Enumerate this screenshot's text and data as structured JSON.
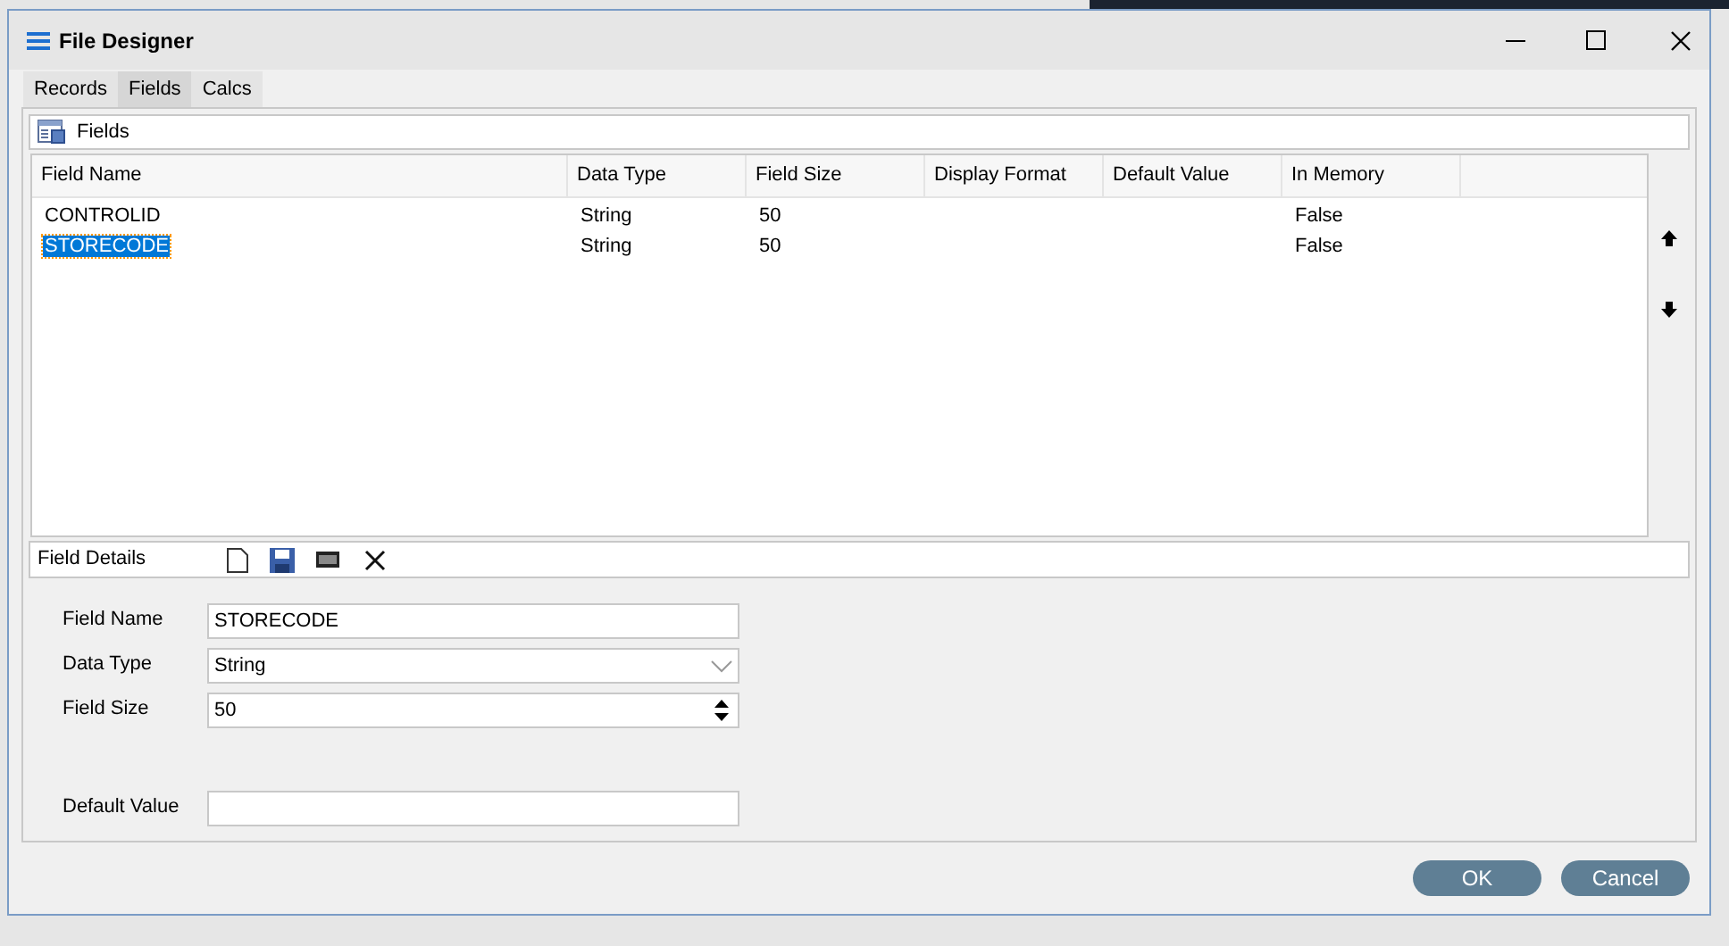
{
  "window": {
    "title": "File Designer"
  },
  "tabs": [
    {
      "label": "Records",
      "selected": false
    },
    {
      "label": "Fields",
      "selected": true
    },
    {
      "label": "Calcs",
      "selected": false
    }
  ],
  "fields_panel": {
    "title": "Fields"
  },
  "table": {
    "columns": [
      "Field Name",
      "Data Type",
      "Field Size",
      "Display Format",
      "Default Value",
      "In Memory"
    ],
    "rows": [
      {
        "cells": [
          "CONTROLID",
          "String",
          "50",
          "",
          "",
          "False"
        ],
        "selected": false
      },
      {
        "cells": [
          "STORECODE",
          "String",
          "50",
          "",
          "",
          "False"
        ],
        "selected": true
      }
    ]
  },
  "field_details": {
    "title": "Field Details",
    "form": [
      {
        "label": "Field Name",
        "kind": "text",
        "value": "STORECODE"
      },
      {
        "label": "Data Type",
        "kind": "select",
        "value": "String"
      },
      {
        "label": "Field Size",
        "kind": "spinner",
        "value": "50"
      },
      {
        "label": "Default Value",
        "kind": "text",
        "gap": true
      }
    ]
  },
  "buttons": [
    "OK",
    "Cancel"
  ]
}
